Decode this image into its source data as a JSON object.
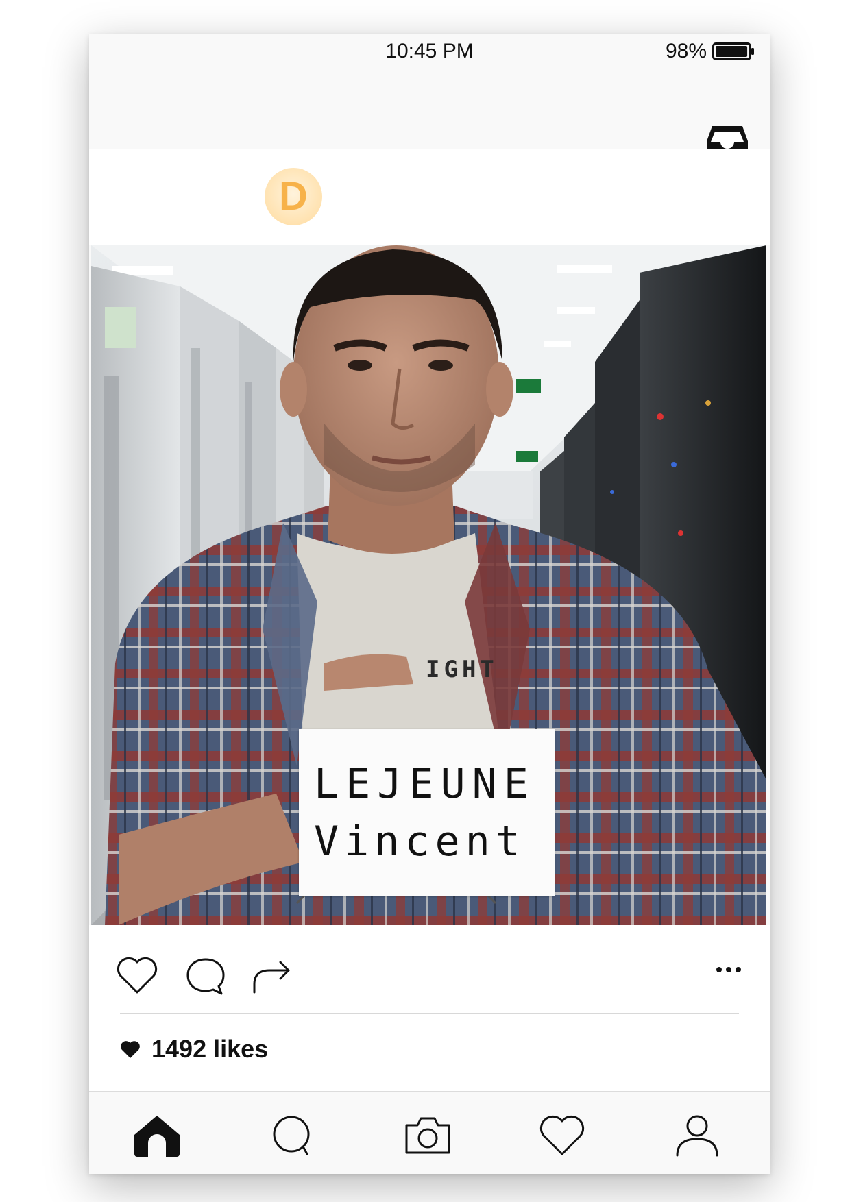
{
  "status_bar": {
    "time": "10:45 PM",
    "battery_percent": "98%",
    "battery_level": 0.98
  },
  "top_bar": {
    "right_icon": "inbox-icon"
  },
  "post": {
    "avatar_letter": "D",
    "avatar_color": "#f7b24a",
    "photo_sign": {
      "line1": "LEJEUNE",
      "line2": "Vincent"
    },
    "shirt_text": "IGHT"
  },
  "actions": {
    "icons": [
      "heart-icon",
      "comment-icon",
      "share-icon",
      "more-icon"
    ],
    "likes_text": "1492 likes"
  },
  "tab_bar": {
    "items": [
      "home-icon",
      "search-icon",
      "camera-icon",
      "heart-icon",
      "profile-icon"
    ],
    "active": "home-icon"
  }
}
